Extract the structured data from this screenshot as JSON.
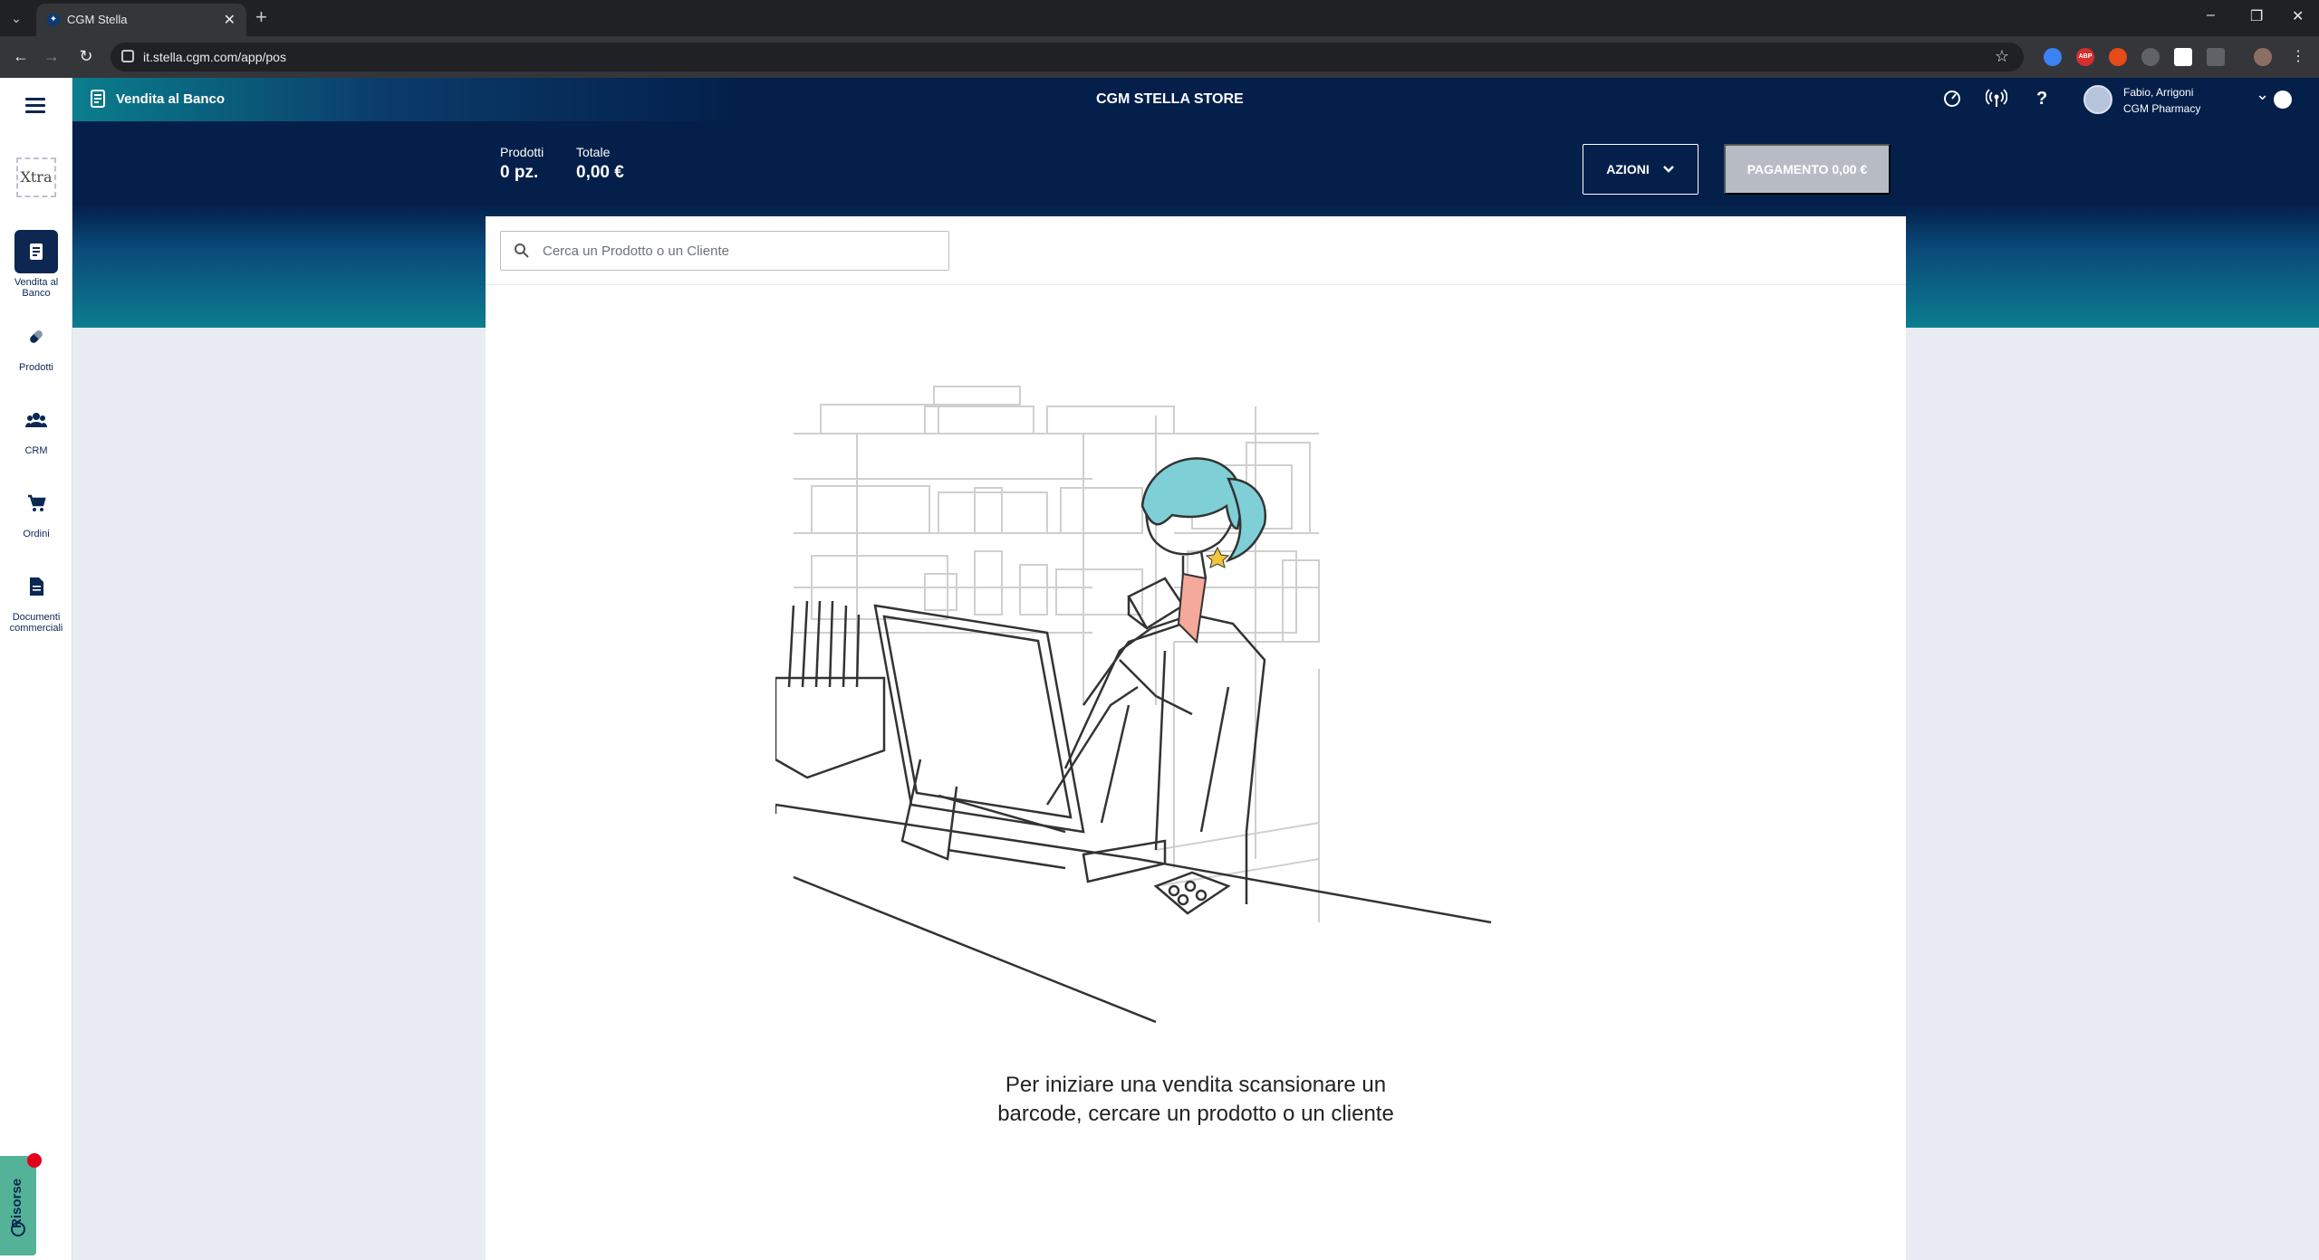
{
  "browser": {
    "tab_title": "CGM Stella",
    "url": "it.stella.cgm.com/app/pos",
    "new_tab": "+",
    "tab_close": "✕",
    "minimize": "–",
    "restore": "❐",
    "close": "✕",
    "extensions": [
      {
        "name": "shield-extension",
        "color": "#3b82f6",
        "text": ""
      },
      {
        "name": "adblock-extension",
        "color": "#d32f2f",
        "text": "ABP"
      },
      {
        "name": "flame-extension",
        "color": "#e64a19",
        "text": ""
      },
      {
        "name": "arrow-extension",
        "color": "#5f6368",
        "text": ""
      },
      {
        "name": "pocket-extension",
        "color": "#ffffff",
        "text": ""
      },
      {
        "name": "puzzle-extension",
        "color": "#5f6368",
        "text": ""
      }
    ]
  },
  "sidebar": {
    "xtra_logo": "Xtra",
    "items": [
      {
        "label": "Vendita al Banco",
        "icon": "receipt-icon",
        "active": true
      },
      {
        "label": "Prodotti",
        "icon": "pill-icon",
        "active": false
      },
      {
        "label": "CRM",
        "icon": "people-icon",
        "active": false
      },
      {
        "label": "Ordini",
        "icon": "cart-icon",
        "active": false
      },
      {
        "label": "Documenti commerciali",
        "icon": "document-icon",
        "active": false
      }
    ],
    "resources_label": "Risorse"
  },
  "header": {
    "app_title": "Vendita al Banco",
    "store_name": "CGM STELLA STORE",
    "help": "?",
    "user_name": "Fabio, Arrigoni",
    "user_org": "CGM Pharmacy"
  },
  "summary": {
    "products_label": "Prodotti",
    "products_value": "0 pz.",
    "total_label": "Totale",
    "total_value": "0,00 €",
    "actions_label": "AZIONI",
    "payment_label": "PAGAMENTO 0,00 €"
  },
  "search": {
    "placeholder": "Cerca un Prodotto o un Cliente",
    "value": ""
  },
  "empty_state": {
    "message_line1": "Per iniziare una vendita scansionare un",
    "message_line2": "barcode, cercare un prodotto o un cliente"
  },
  "colors": {
    "navy": "#031f4a",
    "teal": "#0b7d8e",
    "payment_disabled": "#b7bcc4",
    "resources": "#54b396",
    "notification": "#e3001b"
  }
}
